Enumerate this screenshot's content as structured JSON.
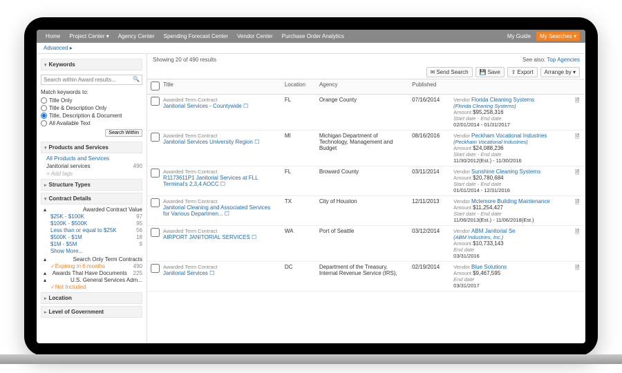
{
  "nav": {
    "home": "Home",
    "project": "Project Center ▾",
    "agency": "Agency Center",
    "spending": "Spending Forecast Center",
    "vendor": "Vendor Center",
    "po": "Purchase Order Analytics",
    "guide": "My Guide",
    "searches": "My Searches ▾"
  },
  "subbar": {
    "advanced": "Advanced ▸"
  },
  "sidebar": {
    "keywords": {
      "title": "Keywords",
      "placeholder": "Search within Award results...",
      "match_label": "Match keywords to:",
      "opts": [
        "Title Only",
        "Title & Description Only",
        "Title, Description & Document",
        "All Available Text"
      ],
      "selected": 2,
      "search_within": "Search Within"
    },
    "products": {
      "title": "Products and Services",
      "all": "All Products and Services",
      "item": "Janitorial services",
      "item_ct": "490",
      "addtags": "+ Add tags"
    },
    "structure": {
      "title": "Structure Types"
    },
    "contract": {
      "title": "Contract Details",
      "acv": "Awarded Contract Value",
      "ranges": [
        [
          "$25K - $100K",
          "97"
        ],
        [
          "$100K - $500K",
          "95"
        ],
        [
          "Less than or equal to $25K",
          "56"
        ],
        [
          "$500K - $1M",
          "18"
        ],
        [
          "$1M - $5M",
          "9"
        ]
      ],
      "more": "Show More...",
      "sotc": "Search Only Term Contracts",
      "sotc_val": "Expiring in 6 months",
      "sotc_ct": "490",
      "ath": "Awards That Have Documents",
      "ath_ct": "225",
      "gsa": "U.S. General Services Adm...",
      "gsa_val": "Not Included"
    },
    "location": {
      "title": "Location"
    },
    "level": {
      "title": "Level of Government"
    }
  },
  "main": {
    "showing": "Showing 20 of 490 results",
    "seealso": "See also:",
    "top_agencies": "Top Agencies",
    "toolbar": {
      "send": "Send Search",
      "save": "Save",
      "export": "Export",
      "arrange": "Arrange by ▾"
    },
    "cols": {
      "chk": "",
      "title": "Title",
      "loc": "Location",
      "agency": "Agency",
      "pub": "Published",
      "vend": ""
    },
    "rows": [
      {
        "type": "Awarded Term Contract",
        "title": "Janitorial Services - Countywide",
        "loc": "FL",
        "agency": "Orange County",
        "pub": "07/16/2014",
        "vendor_lbl": "Vendor",
        "vendor": "Florida Cleaning Systems",
        "vendor_sub": "(Florida Cleaning Systems)",
        "amount_lbl": "Amount",
        "amount": "$95,258,316",
        "date_lbl": "Start date - End date",
        "dates": "02/01/2014 - 01/31/2017"
      },
      {
        "type": "Awarded Term Contract",
        "title": "Janitorial Services University Region",
        "loc": "MI",
        "agency": "Michigan Department of Technology, Management and Budget",
        "pub": "08/16/2016",
        "vendor_lbl": "Vendor",
        "vendor": "Peckham Vocational Industries",
        "vendor_sub": "(Peckham Vocational Industries)",
        "amount_lbl": "Amount",
        "amount": "$24,088,236",
        "date_lbl": "Start date - End date",
        "dates": "11/30/2012(Est.) - 11/30/2016"
      },
      {
        "type": "Awarded Term Contract",
        "title": "R1173611P1 Janitorial Services at FLL Terminal's 2,3,4 AOCC",
        "loc": "FL",
        "agency": "Broward County",
        "pub": "03/11/2014",
        "vendor_lbl": "Vendor",
        "vendor": "Sunshine Cleaning Systems",
        "vendor_sub": "",
        "amount_lbl": "Amount",
        "amount": "$20,780,684",
        "date_lbl": "Start date - End date",
        "dates": "01/01/2014 - 12/31/2016"
      },
      {
        "type": "Awarded Term Contract",
        "title": "Janitorial Cleaning and Associated Services for Various Departmen...",
        "loc": "TX",
        "agency": "City of Houston",
        "pub": "12/11/2013",
        "vendor_lbl": "Vendor",
        "vendor": "Mclemore Building Maintenance",
        "vendor_sub": "",
        "amount_lbl": "Amount",
        "amount": "$11,254,427",
        "date_lbl": "Start date - End date",
        "dates": "11/06/2013(Est.) - 11/06/2018(Est.)"
      },
      {
        "type": "Awarded Term Contract",
        "title": "AIRPORT JANITORIAL SERVICES",
        "loc": "WA",
        "agency": "Port of Seattle",
        "pub": "03/12/2014",
        "vendor_lbl": "Vendor",
        "vendor": "ABM Janitorial Se",
        "vendor_sub": "(ABM Industries, Inc.)",
        "amount_lbl": "Amount",
        "amount": "$10,733,143",
        "date_lbl": "End date",
        "dates": "03/31/2016"
      },
      {
        "type": "Awarded Term Contract",
        "title": "Janitorial Services",
        "loc": "DC",
        "agency": "Department of the Treasury, Internal Revenue Service (IRS),",
        "pub": "02/19/2014",
        "vendor_lbl": "Vendor",
        "vendor": "Blue Solutions",
        "vendor_sub": "",
        "amount_lbl": "Amount",
        "amount": "$9,467,595",
        "date_lbl": "End date",
        "dates": "03/31/2017"
      }
    ]
  }
}
